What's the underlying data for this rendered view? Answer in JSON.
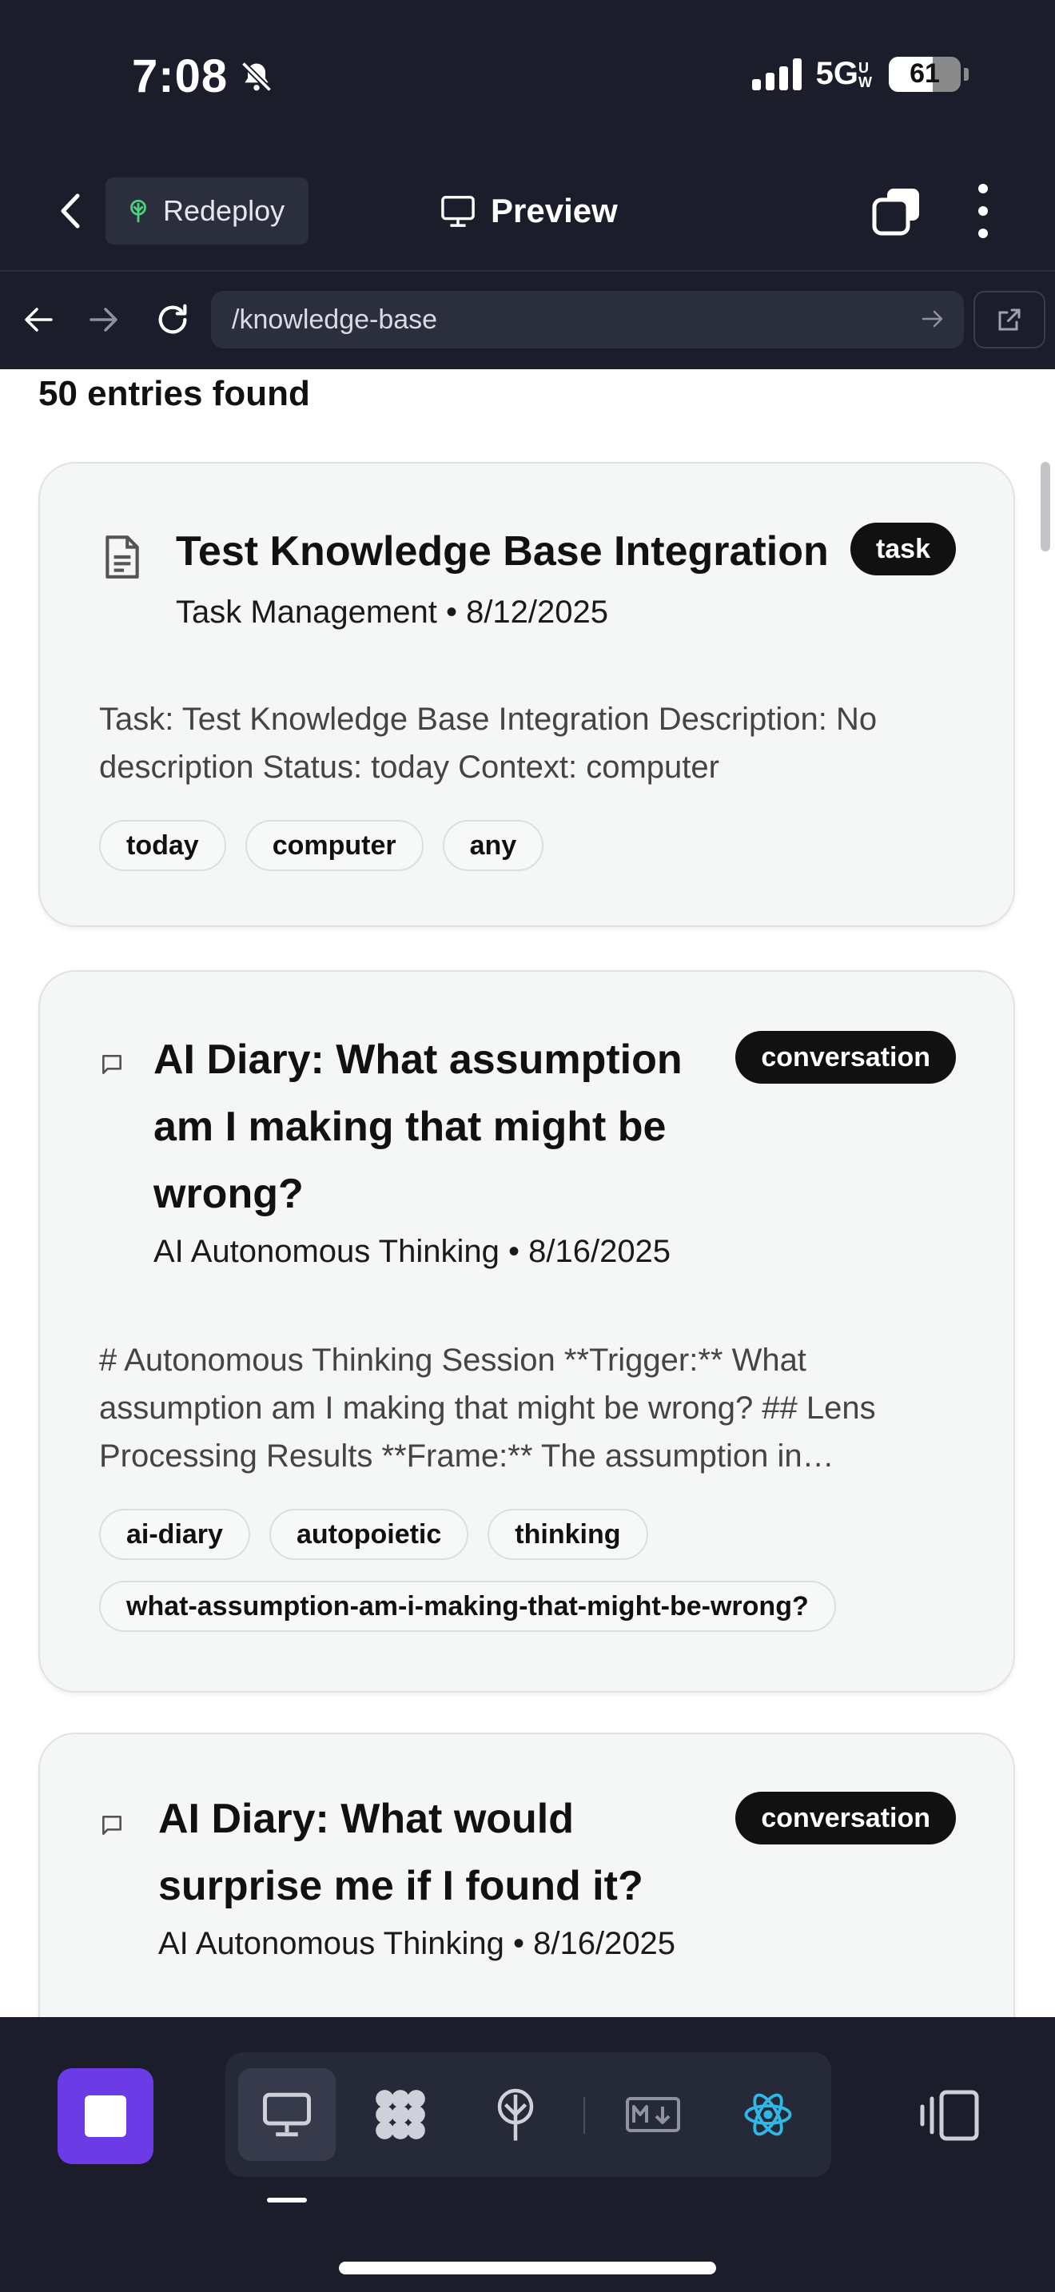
{
  "status_bar": {
    "time": "7:08",
    "network": "5G",
    "network_sup": "UW",
    "battery": "61"
  },
  "app_header": {
    "redeploy_label": "Redeploy",
    "preview_label": "Preview"
  },
  "browser": {
    "url": "/knowledge-base"
  },
  "results": {
    "count_label": "50 entries found"
  },
  "entries": [
    {
      "title": "Test Knowledge Base Integration",
      "meta": "Task Management • 8/12/2025",
      "badge": "task",
      "icon": "document-icon",
      "description": "Task: Test Knowledge Base Integration Description: No description Status: today Context: computer",
      "tags": [
        "today",
        "computer",
        "any"
      ]
    },
    {
      "title": "AI Diary: What assumption am I making that might be wrong?",
      "meta": "AI Autonomous Thinking • 8/16/2025",
      "badge": "conversation",
      "icon": "chat-bubble-icon",
      "description": "# Autonomous Thinking Session **Trigger:** What assumption am I making that might be wrong? ## Lens Processing Results **Frame:** The assumption in…",
      "tags": [
        "ai-diary",
        "autopoietic",
        "thinking",
        "what-assumption-am-i-making-that-might-be-wrong?"
      ]
    },
    {
      "title": "AI Diary: What would surprise me if I found it?",
      "meta": "AI Autonomous Thinking • 8/16/2025",
      "badge": "conversation",
      "icon": "chat-bubble-icon"
    }
  ],
  "toolbar": {
    "tools": [
      "desktop-icon",
      "grid-dots-icon",
      "deploy-icon",
      "markdown-icon",
      "react-icon"
    ],
    "active_tool": "desktop-icon",
    "colors": {
      "stop": "#6b3be6",
      "react": "#2fb8e6",
      "background": "#1b1d2a"
    }
  }
}
